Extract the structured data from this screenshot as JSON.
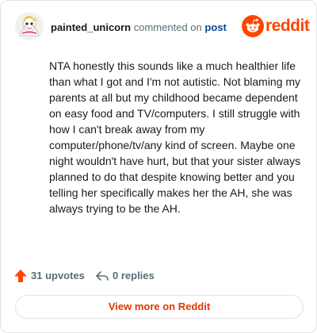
{
  "header": {
    "username": "painted_unicorn",
    "action_text": "commented on",
    "post_link": "post",
    "brand_name": "reddit",
    "brand_color": "#ff4500",
    "avatar_icon": "unicorn-avatar-icon"
  },
  "comment": {
    "body": "NTA honestly this sounds like a much healthier life than what I got and I'm not autistic. Not blaming my parents at all but my childhood became dependent on easy food and TV/computers. I still struggle with how I can't break away from my computer/phone/tv/any kind of screen. Maybe one night wouldn't have hurt, but that your sister always planned to do that despite knowing better and you telling her specifically makes her the AH, she was always trying to be the AH."
  },
  "stats": {
    "upvotes_label": "31 upvotes",
    "upvote_icon": "upvote-arrow-icon",
    "upvote_color": "#ff4500",
    "replies_label": "0 replies",
    "reply_icon": "reply-arrow-icon"
  },
  "footer": {
    "view_more_label": "View more on Reddit",
    "accent_color": "#d93a00"
  }
}
